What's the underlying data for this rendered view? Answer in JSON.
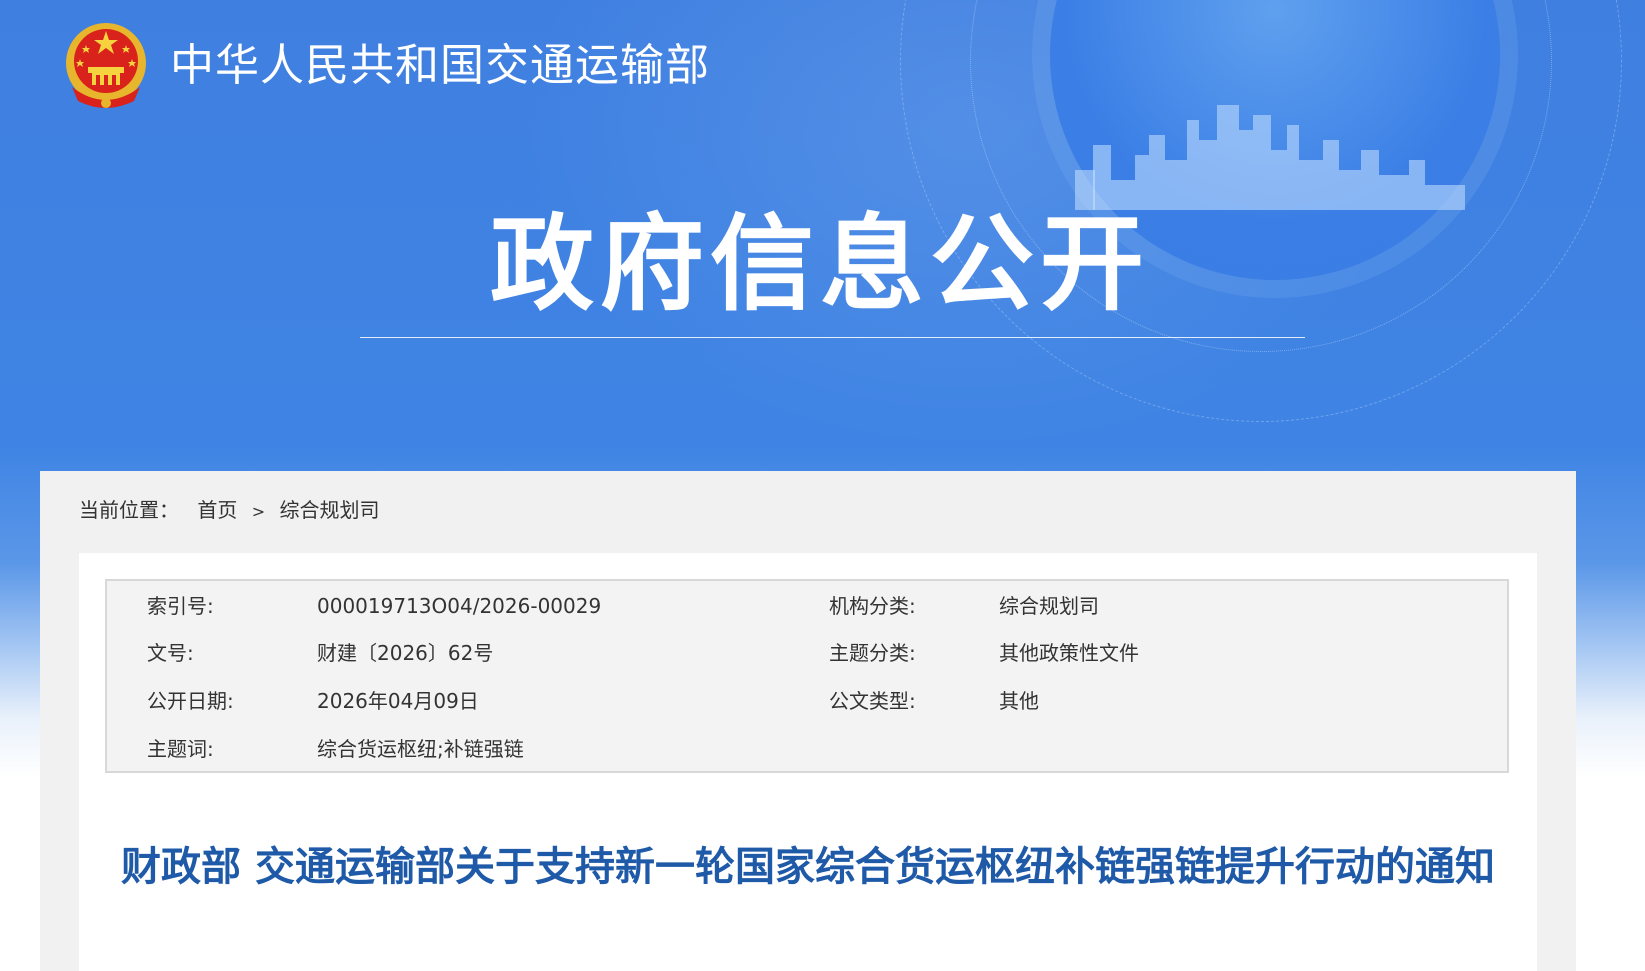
{
  "header": {
    "ministry_name": "中华人民共和国交通运输部",
    "section_title": "政府信息公开"
  },
  "breadcrumb": {
    "label": "当前位置：",
    "items": [
      "首页",
      "综合规划司"
    ],
    "separator": ">"
  },
  "meta": {
    "rows": [
      {
        "k1": "索引号:",
        "v1": "000019713O04/2026-00029",
        "k2": "机构分类:",
        "v2": "综合规划司"
      },
      {
        "k1": "文号:",
        "v1": "财建〔2026〕62号",
        "k2": "主题分类:",
        "v2": "其他政策性文件"
      },
      {
        "k1": "公开日期:",
        "v1": "2026年04月09日",
        "k2": "公文类型:",
        "v2": "其他"
      },
      {
        "k1": "主题词:",
        "v1": "综合货运枢纽;补链强链",
        "k2": "",
        "v2": ""
      }
    ]
  },
  "document": {
    "title": "财政部 交通运输部关于支持新一轮国家综合货运枢纽补链强链提升行动的通知"
  },
  "colors": {
    "banner_blue": "#3f7fe0",
    "title_blue": "#1f5aa8",
    "panel_grey": "#f1f1f1"
  },
  "icons": [
    "national-emblem-icon",
    "city-skyline-icon"
  ]
}
